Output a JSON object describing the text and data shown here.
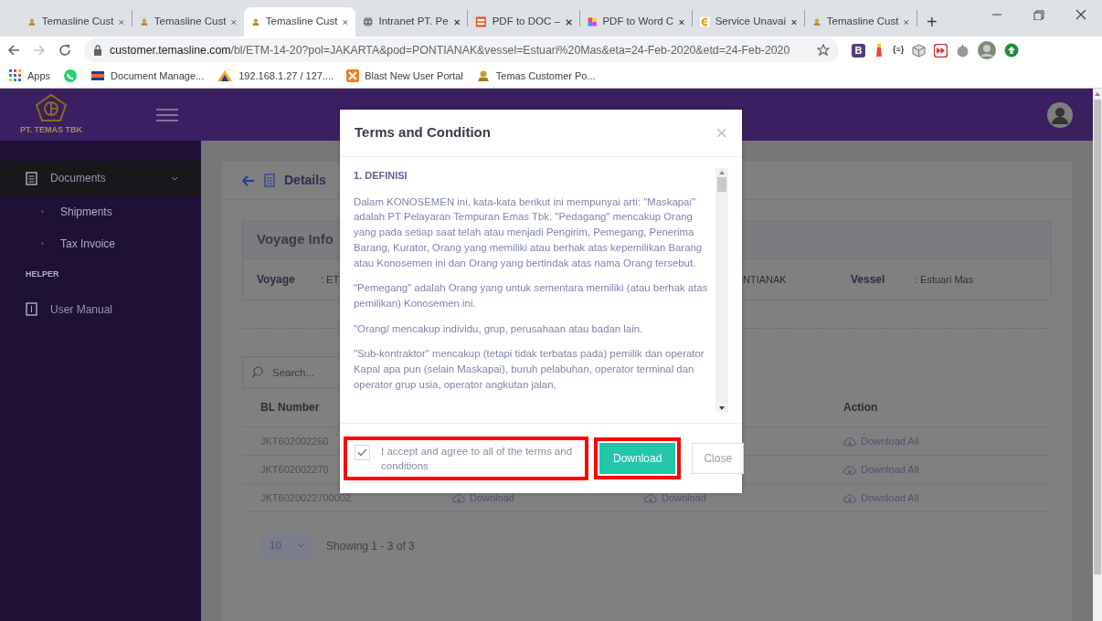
{
  "browser": {
    "tabs": [
      {
        "title": "Temasline Cust",
        "kind": "logo",
        "selected": false
      },
      {
        "title": "Temasline Cust",
        "kind": "logo",
        "selected": false
      },
      {
        "title": "Temasline Cust",
        "kind": "logo",
        "selected": true
      },
      {
        "title": "Intranet PT. Pe",
        "kind": "globe",
        "selected": false
      },
      {
        "title": "PDF to DOC –",
        "kind": "pdf",
        "selected": false
      },
      {
        "title": "PDF to Word C",
        "kind": "colors",
        "selected": false
      },
      {
        "title": "Service Unavai",
        "kind": "service",
        "selected": false
      },
      {
        "title": "Temasline Cust",
        "kind": "logo",
        "selected": false
      }
    ],
    "new_tab": "+",
    "url_host": "customer.temasline.com",
    "url_path": "/bl/ETM-14-20?pol=JAKARTA&pod=PONTIANAK&vessel=Estuari%20Mas&eta=24-Feb-2020&etd=24-Feb-2020",
    "extensions": [
      {
        "kind": "letter",
        "label": "B"
      },
      {
        "kind": "lighthouse"
      },
      {
        "kind": "small-text",
        "label": "{≡}"
      },
      {
        "kind": "cube"
      },
      {
        "kind": "forward"
      },
      {
        "kind": "apple"
      },
      {
        "kind": "avatar"
      },
      {
        "kind": "upload"
      }
    ],
    "bookmarks": [
      {
        "kind": "apps",
        "label": "Apps"
      },
      {
        "kind": "chat"
      },
      {
        "kind": "flag",
        "label": "Document Manage..."
      },
      {
        "kind": "pma",
        "label": "192.168.1.27 / 127...."
      },
      {
        "kind": "blast",
        "label": "Blast New User Portal"
      },
      {
        "kind": "logo",
        "label": "Temas Customer Po..."
      }
    ]
  },
  "brand": "PT. TEMAS TBK",
  "sidebar": {
    "items": [
      {
        "kind": "item",
        "label": "Documents",
        "selected": true,
        "expanded": true,
        "children": [
          {
            "label": "Shipments",
            "selected": false
          },
          {
            "label": "Tax Invoice",
            "selected": false
          }
        ]
      },
      {
        "kind": "section",
        "label": "HELPER"
      },
      {
        "kind": "item",
        "label": "User Manual",
        "selected": false
      }
    ]
  },
  "details": {
    "title": "Details",
    "voyage_info": {
      "title": "Voyage Info",
      "fields": [
        {
          "label": "Voyage",
          "value": ": ET"
        },
        {
          "value": "NTIANAK"
        },
        {
          "label": "Vessel",
          "value": ": Estuari Mas"
        }
      ]
    },
    "search": {
      "placeholder": "Search..."
    },
    "table": {
      "columns": {
        "bl_number": "BL Number",
        "action": "Action"
      },
      "rows": [
        {
          "bl_number": "JKT602002260",
          "action": "Download All"
        },
        {
          "bl_number": "JKT602002270",
          "action": "Download All"
        },
        {
          "bl_number": "JKT6020022700002",
          "download_1": "Download",
          "download_2": "Download",
          "action": "Download All"
        }
      ]
    },
    "page_size": "10",
    "summary": "Showing 1 - 3 of 3"
  },
  "modal": {
    "title": "Terms and Condition",
    "close": "×",
    "heading": "1. DEFINISI",
    "paragraphs": [
      "Dalam KONOSEMEN ini, kata-kata berikut ini mempunyai arti: \"Maskapai\" adalah PT Pelayaran Tempuran Emas Tbk. \"Pedagang\" mencakup Orang yang pada setiap saat telah atau menjadi Pengirim, Pemegang, Penerima Barang, Kurator, Orang yang memiliki atau berhak atas kepemilikan Barang atau Konosemen ini dan Orang yang bertindak atas nama Orang tersebut.",
      "\"Pemegang\" adalah Orang yang untuk sementara memiliki (atau berhak atas pemilikan) Konosemen ini.",
      "\"Orang/ mencakup individu, grup, perusahaan atau badan lain.",
      "\"Sub-kontraktor\" mencakup (tetapi tidak terbatas pada) pemilik dan operator Kapal apa pun (selain Maskapai), buruh pelabuhan, operator terminal dan operator grup usia, operator angkutan jalan,"
    ],
    "accept": {
      "label": "I accept and agree to all of the terms and conditions",
      "checked": true,
      "highlighted": true
    },
    "buttons": [
      {
        "label": "Download",
        "kind": "primary",
        "highlighted": true
      },
      {
        "label": "Close",
        "kind": "secondary",
        "highlighted": false
      }
    ]
  }
}
